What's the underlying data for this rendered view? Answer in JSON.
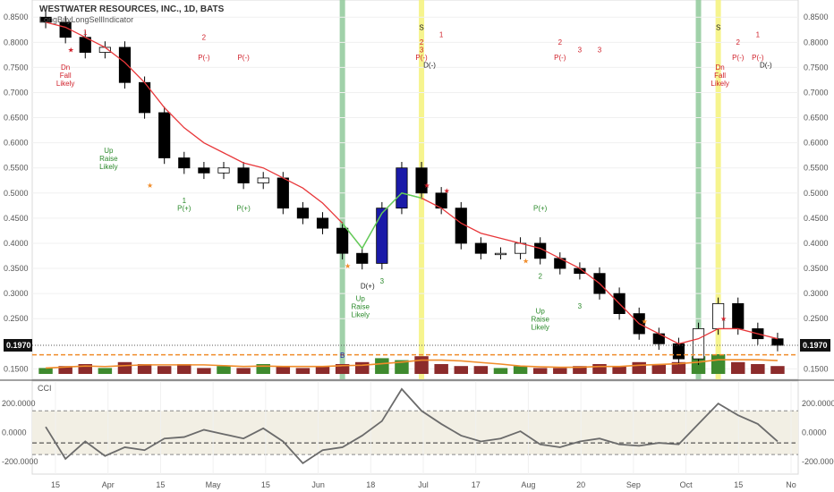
{
  "header": {
    "title": "WESTWATER RESOURCES, INC., 1D, BATS",
    "indicator": "LongBuyLongSellIndicator"
  },
  "price_axis": {
    "ticks": [
      "0.8500",
      "0.8000",
      "0.7500",
      "0.7000",
      "0.6500",
      "0.6000",
      "0.5500",
      "0.5000",
      "0.4500",
      "0.4000",
      "0.3500",
      "0.3000",
      "0.2500",
      "0.1500"
    ],
    "last_price_tag": "0.1970"
  },
  "cci_panel": {
    "label": "CCI",
    "ticks": [
      "200.0000",
      "0.0000",
      "-200.0000"
    ]
  },
  "time_axis": {
    "labels": [
      "15",
      "Apr",
      "15",
      "May",
      "15",
      "Jun",
      "18",
      "Jul",
      "17",
      "Aug",
      "20",
      "Sep",
      "Oct",
      "15",
      "No"
    ]
  },
  "colors": {
    "bull_volume": "#3e8a2e",
    "bear_volume": "#8c2b2b",
    "ema": "#e8373a",
    "ema_up": "#5bd35b",
    "volume_ma": "#f08c2a",
    "support": "#f08c2a",
    "green_band": "#8fc99a",
    "yellow_band": "#f5f27a",
    "cci_line": "#6b6b6b",
    "cci_band": "#f2efe4",
    "signal_red": "#d0202a",
    "signal_green": "#2b8a2b",
    "signal_blue": "#1a1aa8"
  },
  "chart_data": [
    {
      "type": "candlestick",
      "title": "WESTWATER RESOURCES, INC., 1D, BATS",
      "ylim": [
        0.14,
        0.87
      ],
      "x": [
        "Mar 7",
        "Mar 11",
        "Mar 13",
        "Mar 15",
        "Mar 19",
        "Mar 21",
        "Mar 25",
        "Apr 2",
        "Apr 9",
        "Apr 16",
        "Apr 23",
        "May 1",
        "May 8",
        "May 15",
        "May 22",
        "Jun 1",
        "Jun 6",
        "Jun 11",
        "Jun 14",
        "Jun 18",
        "Jun 25",
        "Jul 2",
        "Jul 10",
        "Jul 17",
        "Jul 24",
        "Aug 1",
        "Aug 8",
        "Aug 15",
        "Aug 22",
        "Aug 29",
        "Sep 6",
        "Sep 13",
        "Sep 20",
        "Sep 26",
        "Sep 27",
        "Oct 2",
        "Oct 8",
        "Oct 15"
      ],
      "close": [
        0.84,
        0.81,
        0.78,
        0.79,
        0.72,
        0.66,
        0.57,
        0.55,
        0.54,
        0.55,
        0.52,
        0.53,
        0.47,
        0.45,
        0.43,
        0.38,
        0.36,
        0.47,
        0.55,
        0.5,
        0.47,
        0.4,
        0.38,
        0.38,
        0.4,
        0.37,
        0.35,
        0.34,
        0.3,
        0.26,
        0.22,
        0.2,
        0.17,
        0.23,
        0.28,
        0.23,
        0.21,
        0.197
      ],
      "series": [
        {
          "name": "EMA",
          "values": [
            0.84,
            0.83,
            0.81,
            0.79,
            0.76,
            0.72,
            0.67,
            0.63,
            0.6,
            0.58,
            0.56,
            0.55,
            0.53,
            0.51,
            0.48,
            0.44,
            0.39,
            0.46,
            0.5,
            0.49,
            0.47,
            0.44,
            0.42,
            0.41,
            0.4,
            0.39,
            0.37,
            0.35,
            0.32,
            0.28,
            0.24,
            0.22,
            0.2,
            0.21,
            0.23,
            0.23,
            0.22,
            0.21
          ]
        }
      ],
      "volume": [
        0.3,
        0.4,
        0.5,
        0.3,
        0.6,
        0.5,
        0.4,
        0.5,
        0.3,
        0.4,
        0.3,
        0.5,
        0.4,
        0.3,
        0.4,
        0.5,
        0.6,
        0.8,
        0.7,
        0.9,
        0.5,
        0.4,
        0.4,
        0.3,
        0.4,
        0.3,
        0.3,
        0.4,
        0.5,
        0.4,
        0.6,
        0.5,
        0.6,
        0.9,
        1.0,
        0.6,
        0.5,
        0.4
      ],
      "support_level": 0.178
    },
    {
      "type": "line",
      "title": "CCI",
      "ylim": [
        -260,
        330
      ],
      "x": [
        "Mar 7",
        "Mar 11",
        "Mar 13",
        "Mar 15",
        "Mar 19",
        "Mar 21",
        "Mar 25",
        "Apr 2",
        "Apr 9",
        "Apr 16",
        "Apr 23",
        "May 1",
        "May 8",
        "May 15",
        "May 22",
        "Jun 1",
        "Jun 6",
        "Jun 11",
        "Jun 14",
        "Jun 18",
        "Jun 25",
        "Jul 2",
        "Jul 10",
        "Jul 17",
        "Jul 24",
        "Aug 1",
        "Aug 8",
        "Aug 15",
        "Aug 22",
        "Aug 29",
        "Sep 6",
        "Sep 13",
        "Sep 20",
        "Sep 26",
        "Sep 27",
        "Oct 2",
        "Oct 8",
        "Oct 15"
      ],
      "values": [
        40,
        -180,
        -60,
        -160,
        -100,
        -120,
        -40,
        -30,
        20,
        -10,
        -40,
        30,
        -60,
        -210,
        -120,
        -100,
        -20,
        80,
        300,
        150,
        60,
        -20,
        -60,
        -40,
        10,
        -80,
        -100,
        -60,
        -40,
        -80,
        -90,
        -70,
        -80,
        60,
        200,
        120,
        60,
        -60
      ],
      "bands": [
        150,
        -150
      ],
      "mid_level": -70
    }
  ],
  "annotations": {
    "dn_fall_likely": "Dn\nFall\nLikely",
    "up_raise_likely": "Up\nRaise\nLikely",
    "p_minus": "P(-)",
    "p_plus": "P(+)",
    "d_minus": "D(-)",
    "d_plus": "D(+)",
    "sell": "S",
    "buy": "B",
    "num1": "1",
    "num2": "2",
    "num3": "3"
  }
}
